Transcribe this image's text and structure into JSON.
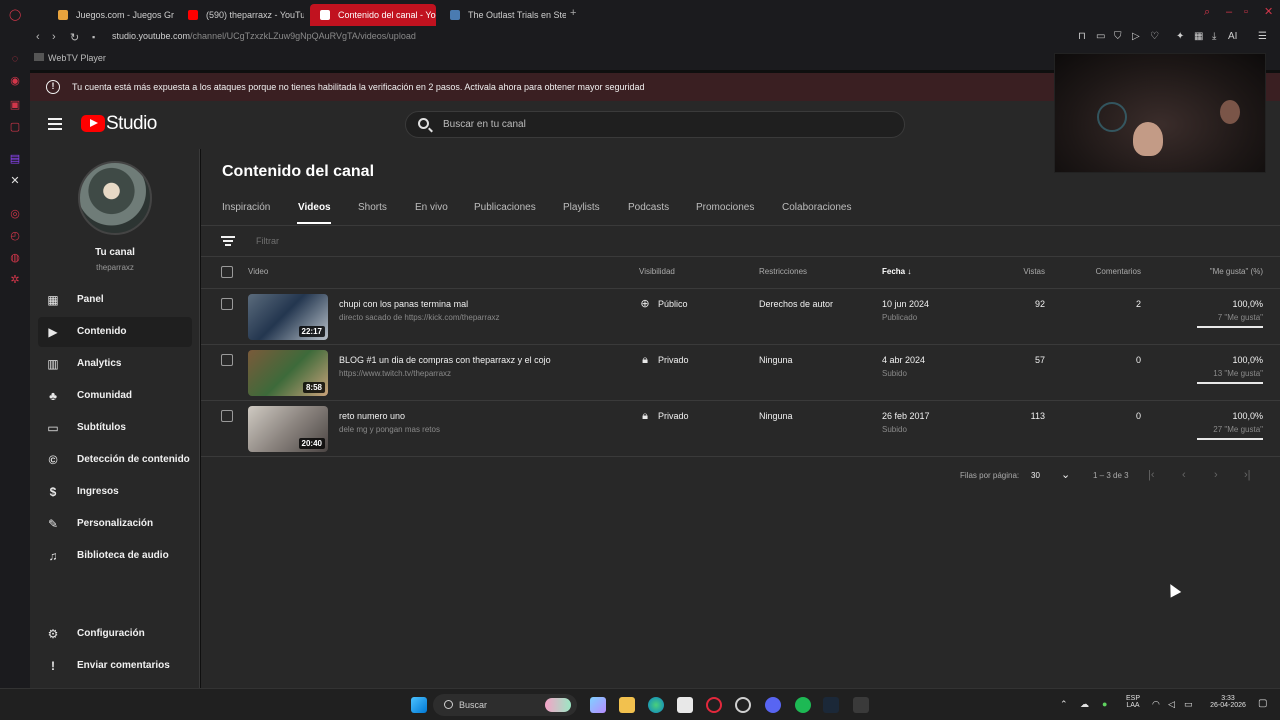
{
  "browser": {
    "tabs": [
      {
        "label": "Juegos.com - Juegos Gra",
        "favicon": "#e8a33d"
      },
      {
        "label": "(590) theparraxz - YouTu",
        "favicon": "#ff0000"
      },
      {
        "label": "Contenido del canal - You",
        "favicon": "#ff0000",
        "active": true
      },
      {
        "label": "The Outlast Trials en Stea",
        "favicon": "#1b2838"
      }
    ],
    "url_domain": "studio.youtube.com",
    "url_path": "/channel/UCgTzxzkLZuw9gNpQAuRVgTA/videos/upload",
    "bookmark": "WebTV Player"
  },
  "banner": {
    "text": "Tu cuenta está más expuesta a los ataques porque no tienes habilitada la verificación en 2 pasos. Activala ahora para obtener mayor seguridad"
  },
  "header": {
    "logo_text": "Studio",
    "search_placeholder": "Buscar en tu canal"
  },
  "sidebar": {
    "channel_name": "Tu canal",
    "channel_handle": "theparraxz",
    "items": [
      {
        "label": "Panel",
        "icon": "dashboard-icon"
      },
      {
        "label": "Contenido",
        "icon": "content-icon",
        "active": true
      },
      {
        "label": "Analytics",
        "icon": "analytics-icon"
      },
      {
        "label": "Comunidad",
        "icon": "community-icon"
      },
      {
        "label": "Subtítulos",
        "icon": "subtitles-icon"
      },
      {
        "label": "Detección de contenido",
        "icon": "copyright-icon"
      },
      {
        "label": "Ingresos",
        "icon": "earn-icon"
      },
      {
        "label": "Personalización",
        "icon": "customization-icon"
      },
      {
        "label": "Biblioteca de audio",
        "icon": "audio-library-icon"
      }
    ],
    "footer": [
      {
        "label": "Configuración",
        "icon": "settings-icon"
      },
      {
        "label": "Enviar comentarios",
        "icon": "feedback-icon"
      }
    ]
  },
  "main": {
    "title": "Contenido del canal",
    "tabs": [
      "Inspiración",
      "Videos",
      "Shorts",
      "En vivo",
      "Publicaciones",
      "Playlists",
      "Podcasts",
      "Promociones",
      "Colaboraciones"
    ],
    "active_tab": "Videos",
    "filter_placeholder": "Filtrar",
    "columns": {
      "video": "Video",
      "visibility": "Visibilidad",
      "restrictions": "Restricciones",
      "date": "Fecha",
      "views": "Vistas",
      "comments": "Comentarios",
      "likes": "\"Me gusta\" (%)"
    },
    "rows": [
      {
        "title": "chupi con los panas termina mal",
        "description": "directo sacado de https://kick.com/theparraxz",
        "duration": "22:17",
        "visibility": "Público",
        "visibility_icon": "globe-icon",
        "restrictions": "Derechos de autor",
        "date": "10 jun 2024",
        "status": "Publicado",
        "views": "92",
        "comments": "2",
        "like_pct": "100,0%",
        "like_count": "7 \"Me gusta\"",
        "like_fraction": 1.0,
        "thumb_colors": [
          "#5b6b7c",
          "#23364f",
          "#b9c1c9"
        ]
      },
      {
        "title": "BLOG #1 un dia de compras con theparraxz y el cojo",
        "description": "https://www.twitch.tv/theparraxz",
        "duration": "8:58",
        "visibility": "Privado",
        "visibility_icon": "lock-icon",
        "restrictions": "Ninguna",
        "date": "4 abr 2024",
        "status": "Subido",
        "views": "57",
        "comments": "0",
        "like_pct": "100,0%",
        "like_count": "13 \"Me gusta\"",
        "like_fraction": 1.0,
        "thumb_colors": [
          "#7a5a3a",
          "#3d6a3a",
          "#c9a27a"
        ]
      },
      {
        "title": "reto numero uno",
        "description": "dele mg y pongan mas retos",
        "duration": "20:40",
        "visibility": "Privado",
        "visibility_icon": "lock-icon",
        "restrictions": "Ninguna",
        "date": "26 feb 2017",
        "status": "Subido",
        "views": "113",
        "comments": "0",
        "like_pct": "100,0%",
        "like_count": "27 \"Me gusta\"",
        "like_fraction": 1.0,
        "thumb_colors": [
          "#cfcac2",
          "#8c8580",
          "#4b4543"
        ]
      }
    ],
    "pagination": {
      "rows_per_page_label": "Filas por página:",
      "rows_per_page": "30",
      "range": "1 – 3 de 3"
    }
  },
  "taskbar": {
    "search_label": "Buscar",
    "lang_top": "ESP",
    "lang_bottom": "LAA",
    "time": "3:33",
    "date": "26-04-2026"
  },
  "colors": {
    "accent_red": "#ff0000",
    "banner_bg": "#3a1f22",
    "panel_bg": "#282828"
  }
}
